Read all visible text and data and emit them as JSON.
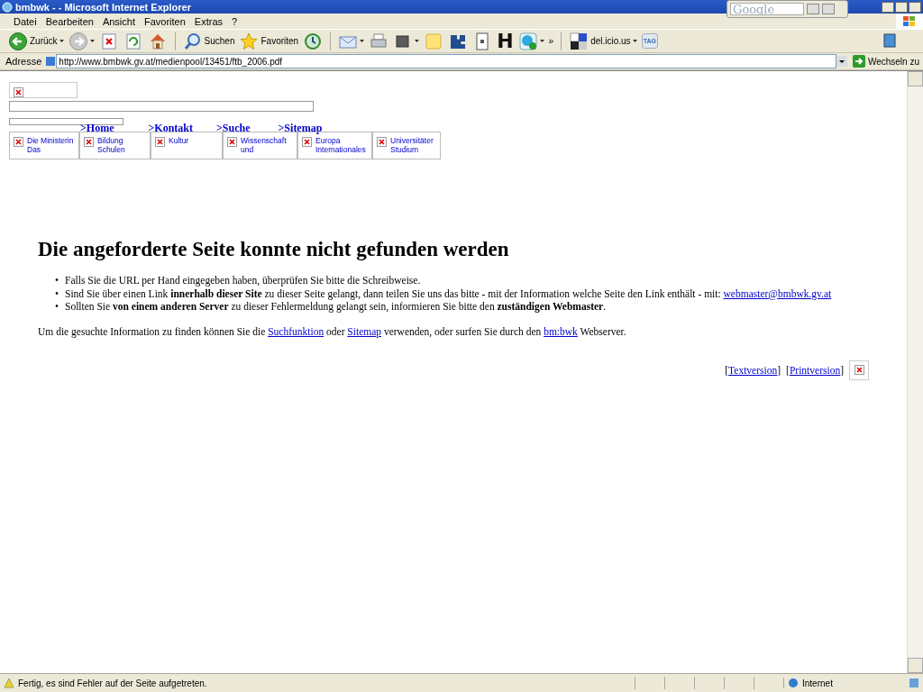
{
  "window": {
    "title": "bmbwk - - Microsoft Internet Explorer",
    "google_search": {
      "placeholder": "Google"
    }
  },
  "menu": [
    "Datei",
    "Bearbeiten",
    "Ansicht",
    "Favoriten",
    "Extras",
    "?"
  ],
  "toolbar": [
    {
      "kind": "back",
      "label": "Zurück",
      "dropdown": true
    },
    {
      "kind": "forward",
      "dropdown": true
    },
    {
      "kind": "stop",
      "dropdown": false
    },
    {
      "kind": "refresh",
      "dropdown": false
    },
    {
      "kind": "home",
      "dropdown": false
    },
    {
      "kind": "search",
      "label": "Suchen",
      "dropdown": false
    },
    {
      "kind": "favorites",
      "label": "Favoriten",
      "dropdown": false
    },
    {
      "kind": "history",
      "dropdown": false
    },
    {
      "kind": "mail",
      "dropdown": true
    },
    {
      "kind": "print",
      "dropdown": false
    },
    {
      "kind": "edit",
      "dropdown": true
    },
    {
      "kind": "note",
      "dropdown": false
    },
    {
      "kind": "puzzle",
      "dropdown": false
    },
    {
      "kind": "page",
      "dropdown": false
    },
    {
      "kind": "letter",
      "label": "H",
      "dropdown": false
    },
    {
      "kind": "skype",
      "dropdown": true
    },
    {
      "kind": "more",
      "label": "»",
      "dropdown": false
    },
    {
      "kind": "delicious",
      "label": "del.icio.us",
      "dropdown": true
    },
    {
      "kind": "tag",
      "label": "TAG",
      "dropdown": false
    }
  ],
  "address": {
    "label": "Adresse",
    "url": "http://www.bmbwk.gv.at/medienpool/13451/ftb_2006.pdf",
    "go": "Wechseln zu"
  },
  "page": {
    "nav_links": [
      ">Home",
      ">Kontakt",
      ">Suche",
      ">Sitemap"
    ],
    "sections": [
      {
        "lines": [
          "Die Ministerin",
          "Das"
        ]
      },
      {
        "lines": [
          "Bildung",
          "Schulen"
        ]
      },
      {
        "lines": [
          "Kultur"
        ]
      },
      {
        "lines": [
          "Wissenschaft",
          "und"
        ]
      },
      {
        "lines": [
          "Europa",
          "Internationales"
        ]
      },
      {
        "lines": [
          "Universitäter",
          "Studium"
        ]
      }
    ],
    "heading": "Die angeforderte Seite konnte nicht gefunden werden",
    "bullets": [
      {
        "marker": "•",
        "text": "Falls Sie die URL per Hand eingegeben haben, überprüfen Sie bitte die Schreibweise."
      },
      {
        "marker": "•",
        "text": "Sind Sie über einen Link **innerhalb dieser Site** zu dieser Seite gelangt, dann teilen Sie uns das bitte - mit der Information welche Seite den Link enthält - mit: ",
        "link": "webmaster@bmbwk.gv.at"
      },
      {
        "marker": "•",
        "text": "Sollten Sie **von einem anderen Server** zu dieser Fehlermeldung gelangt sein, informieren Sie bitte den **zuständigen Webmaster**."
      }
    ],
    "help": [
      {
        "text": "Um die gesuchte Information zu finden können Sie die "
      },
      {
        "link": "Suchfunktion"
      },
      {
        "text": " oder "
      },
      {
        "link": "Sitemap"
      },
      {
        "text": " verwenden, oder surfen Sie durch den "
      },
      {
        "link": "bm:bwk"
      },
      {
        "text": " Webserver."
      }
    ],
    "footer_links": [
      {
        "before": "[",
        "link": "Textversion",
        "after": "]"
      },
      {
        "before": "[",
        "link": "Printversion",
        "after": "]"
      }
    ]
  },
  "status": {
    "text": "Fertig, es sind Fehler auf der Seite aufgetreten.",
    "zone": "Internet"
  }
}
